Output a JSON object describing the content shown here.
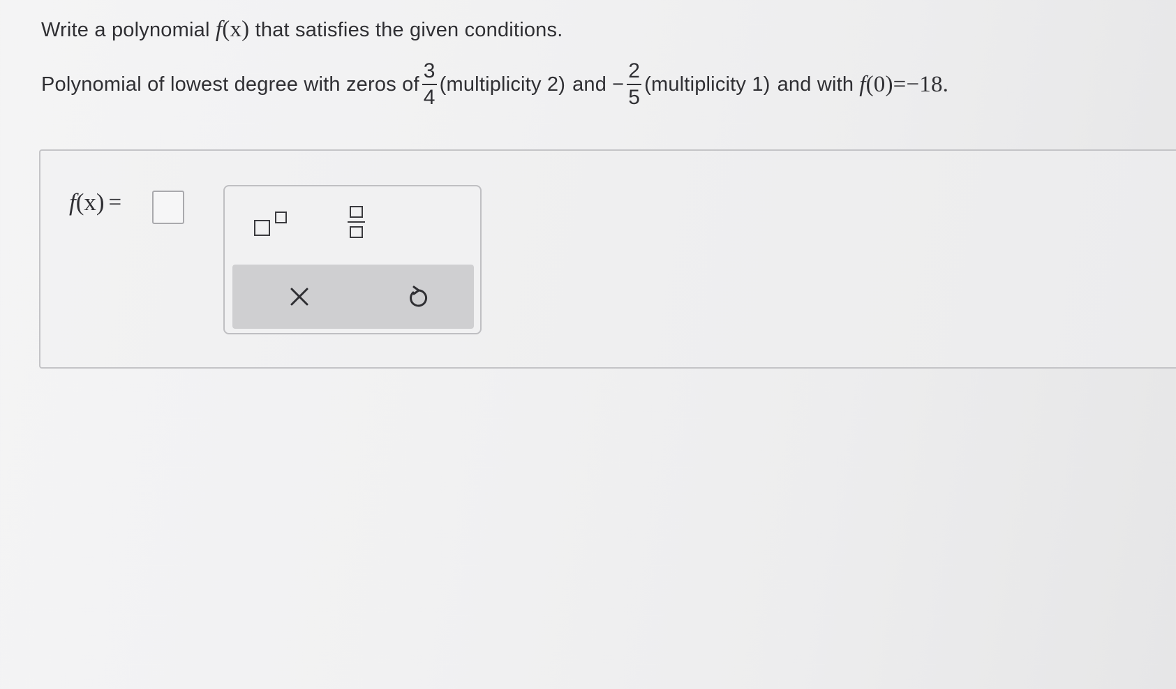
{
  "question": {
    "line1_prefix": "Write a polynomial",
    "line1_func_name": "f",
    "line1_func_arg": "(x)",
    "line1_suffix": "that satisfies the given conditions.",
    "line2_prefix": "Polynomial of lowest degree with zeros of",
    "zero1": {
      "numerator": "3",
      "denominator": "4"
    },
    "zero1_mult": "(multiplicity 2)",
    "and_text": "and",
    "zero2_sign": "−",
    "zero2": {
      "numerator": "2",
      "denominator": "5"
    },
    "zero2_mult": "(multiplicity 1)",
    "and_with_text": "and with",
    "condition_func": "f",
    "condition_rest": "(0)=−18."
  },
  "answer": {
    "label_func": "f",
    "label_arg": "(x)",
    "label_eq": "=",
    "value": ""
  },
  "toolbar": {
    "superscript_icon": "superscript-template-icon",
    "fraction_icon": "fraction-template-icon",
    "clear_icon": "close-icon",
    "undo_icon": "undo-icon"
  },
  "colors": {
    "text": "#2f2f33",
    "panel_border": "#c4c4c7",
    "action_bar": "#cfcfd1"
  }
}
